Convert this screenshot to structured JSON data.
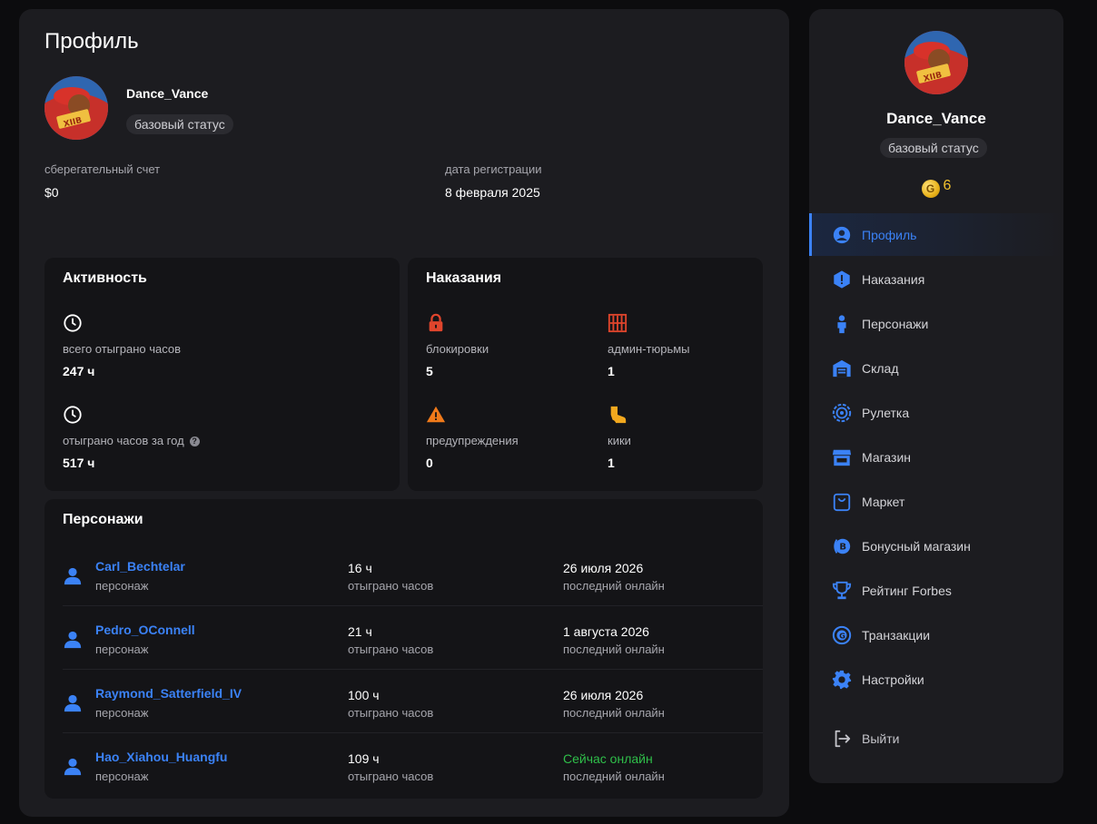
{
  "profile": {
    "title": "Профиль",
    "username": "Dance_Vance",
    "status": "базовый статус",
    "savings_label": "сберегательный счет",
    "savings_value": "$0",
    "regdate_label": "дата регистрации",
    "regdate_value": "8 февраля 2025"
  },
  "activity": {
    "title": "Активность",
    "total_hours_label": "всего отыграно часов",
    "total_hours_value": "247 ч",
    "year_hours_label": "отыграно часов за год",
    "year_hours_value": "517 ч"
  },
  "punishments": {
    "title": "Наказания",
    "items": [
      {
        "label": "блокировки",
        "value": "5",
        "icon": "lock-icon"
      },
      {
        "label": "админ-тюрьмы",
        "value": "1",
        "icon": "jail-icon"
      },
      {
        "label": "предупреждения",
        "value": "0",
        "icon": "warning-icon"
      },
      {
        "label": "кики",
        "value": "1",
        "icon": "boot-icon"
      }
    ]
  },
  "characters": {
    "title": "Персонажи",
    "rows": [
      {
        "name": "Carl_Bechtelar",
        "type": "персонаж",
        "hours": "16 ч",
        "hours_label": "отыграно часов",
        "last_online": "26 июля 2026",
        "last_online_label": "последний онлайн",
        "online": false
      },
      {
        "name": "Pedro_OConnell",
        "type": "персонаж",
        "hours": "21 ч",
        "hours_label": "отыграно часов",
        "last_online": "1 августа 2026",
        "last_online_label": "последний онлайн",
        "online": false
      },
      {
        "name": "Raymond_Satterfield_IV",
        "type": "персонаж",
        "hours": "100 ч",
        "hours_label": "отыграно часов",
        "last_online": "26 июля 2026",
        "last_online_label": "последний онлайн",
        "online": false
      },
      {
        "name": "Hao_Xiahou_Huangfu",
        "type": "персонаж",
        "hours": "109 ч",
        "hours_label": "отыграно часов",
        "last_online": "Сейчас онлайн",
        "last_online_label": "последний онлайн",
        "online": true
      }
    ]
  },
  "sidebar": {
    "username": "Dance_Vance",
    "status": "базовый статус",
    "coins": "6",
    "coin_symbol": "G",
    "items": [
      {
        "label": "Профиль",
        "icon": "user-circle-icon",
        "active": true
      },
      {
        "label": "Наказания",
        "icon": "alert-hexagon-icon",
        "active": false
      },
      {
        "label": "Персонажи",
        "icon": "person-icon",
        "active": false
      },
      {
        "label": "Склад",
        "icon": "warehouse-icon",
        "active": false
      },
      {
        "label": "Рулетка",
        "icon": "roulette-icon",
        "active": false
      },
      {
        "label": "Магазин",
        "icon": "store-icon",
        "active": false
      },
      {
        "label": "Маркет",
        "icon": "shopping-bag-icon",
        "active": false
      },
      {
        "label": "Бонусный магазин",
        "icon": "bonus-coin-icon",
        "active": false
      },
      {
        "label": "Рейтинг Forbes",
        "icon": "trophy-icon",
        "active": false
      },
      {
        "label": "Транзакции",
        "icon": "coin-transfer-icon",
        "active": false
      },
      {
        "label": "Настройки",
        "icon": "gear-icon",
        "active": false
      }
    ],
    "logout": "Выйти"
  },
  "colors": {
    "accent": "#3b82f6",
    "online": "#2fbf4a",
    "punishment_red": "#e0452c",
    "punishment_orange": "#f07a1a",
    "coin": "#f2c12e",
    "panel": "#1c1c20",
    "card": "#141417",
    "background": "#0c0c0e"
  }
}
